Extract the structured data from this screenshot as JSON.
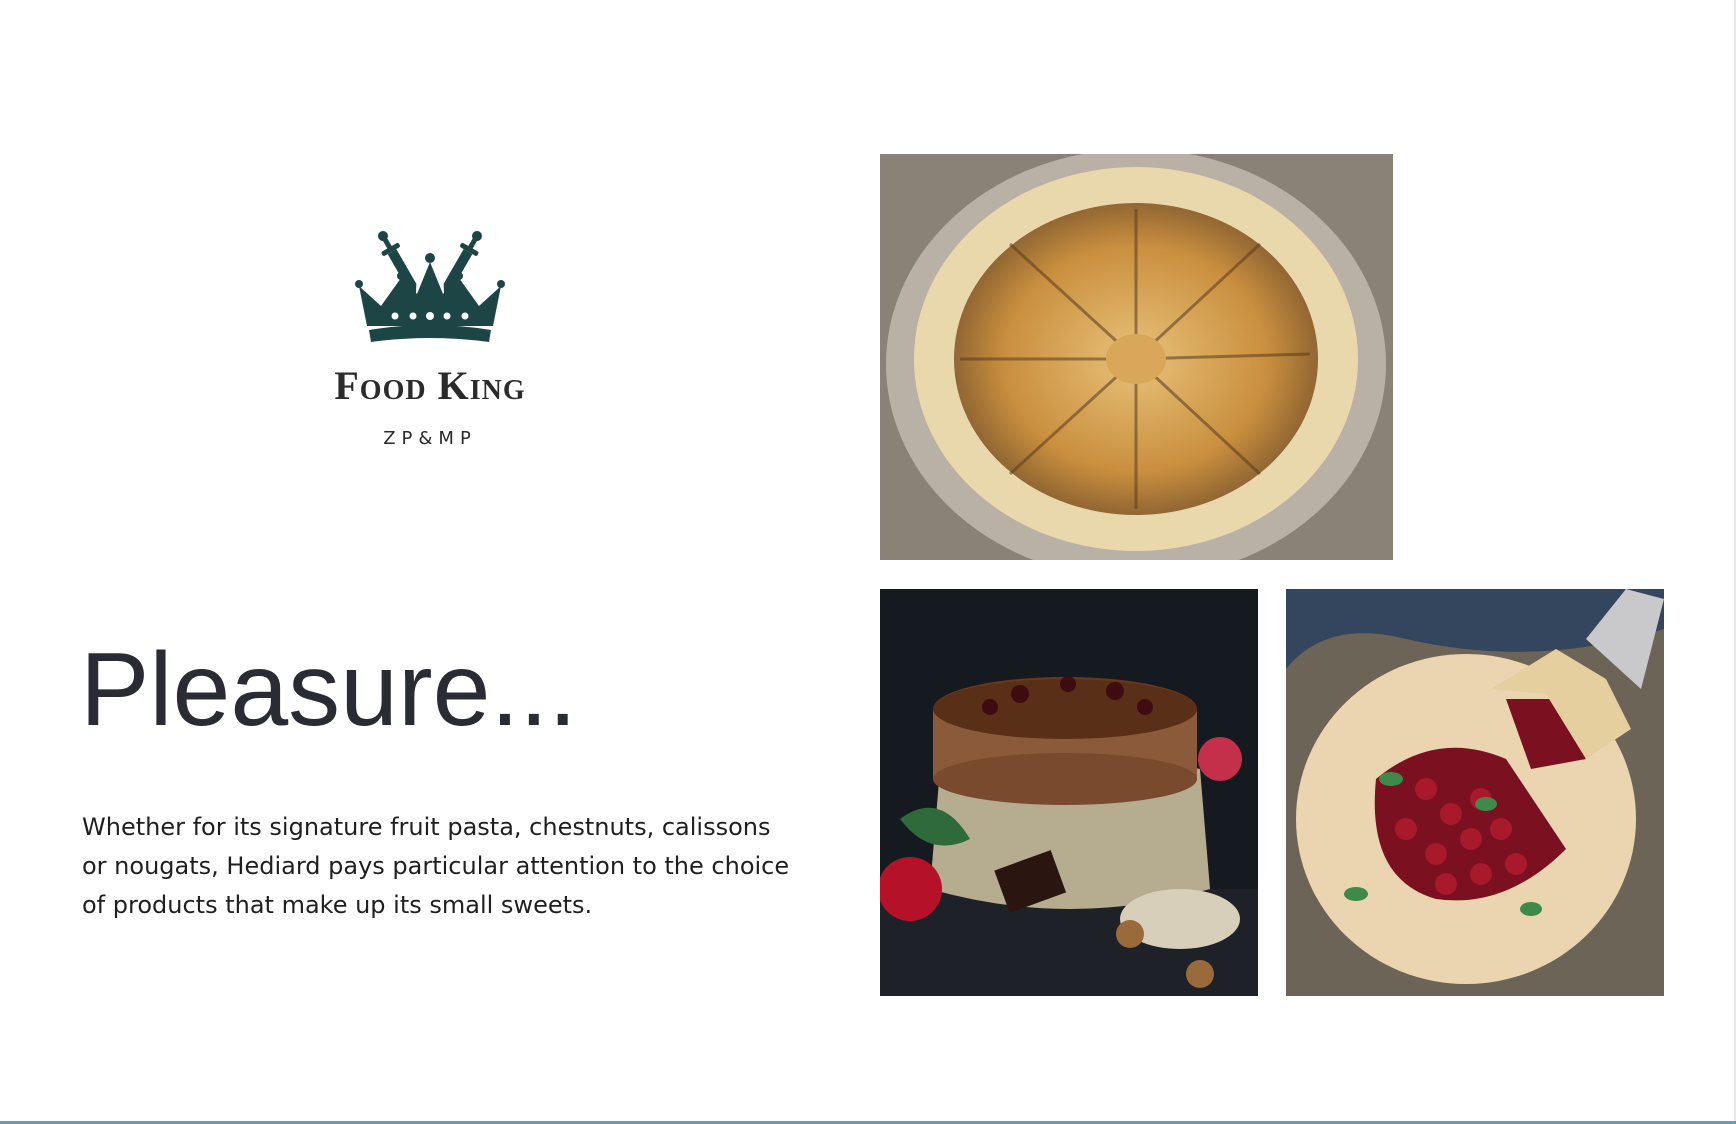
{
  "brand": {
    "name": "Food King",
    "subtitle": "ZP&MP",
    "logo_icon": "crown-with-swords-icon",
    "color": "#1e4545"
  },
  "headline": "Pleasure...",
  "body_text": "Whether for its signature fruit pasta, chestnuts, calissons or nougats, Hediard pays particular attention to the choice of products that make up its small sweets.",
  "colors": {
    "heading": "#2a2c33",
    "body": "#1f1f1f",
    "bottom_rule": "#5b9fc1"
  },
  "photos": [
    {
      "name": "apple-galette-photo"
    },
    {
      "name": "chocolate-cherry-cake-photo"
    },
    {
      "name": "cherry-galette-photo"
    }
  ]
}
